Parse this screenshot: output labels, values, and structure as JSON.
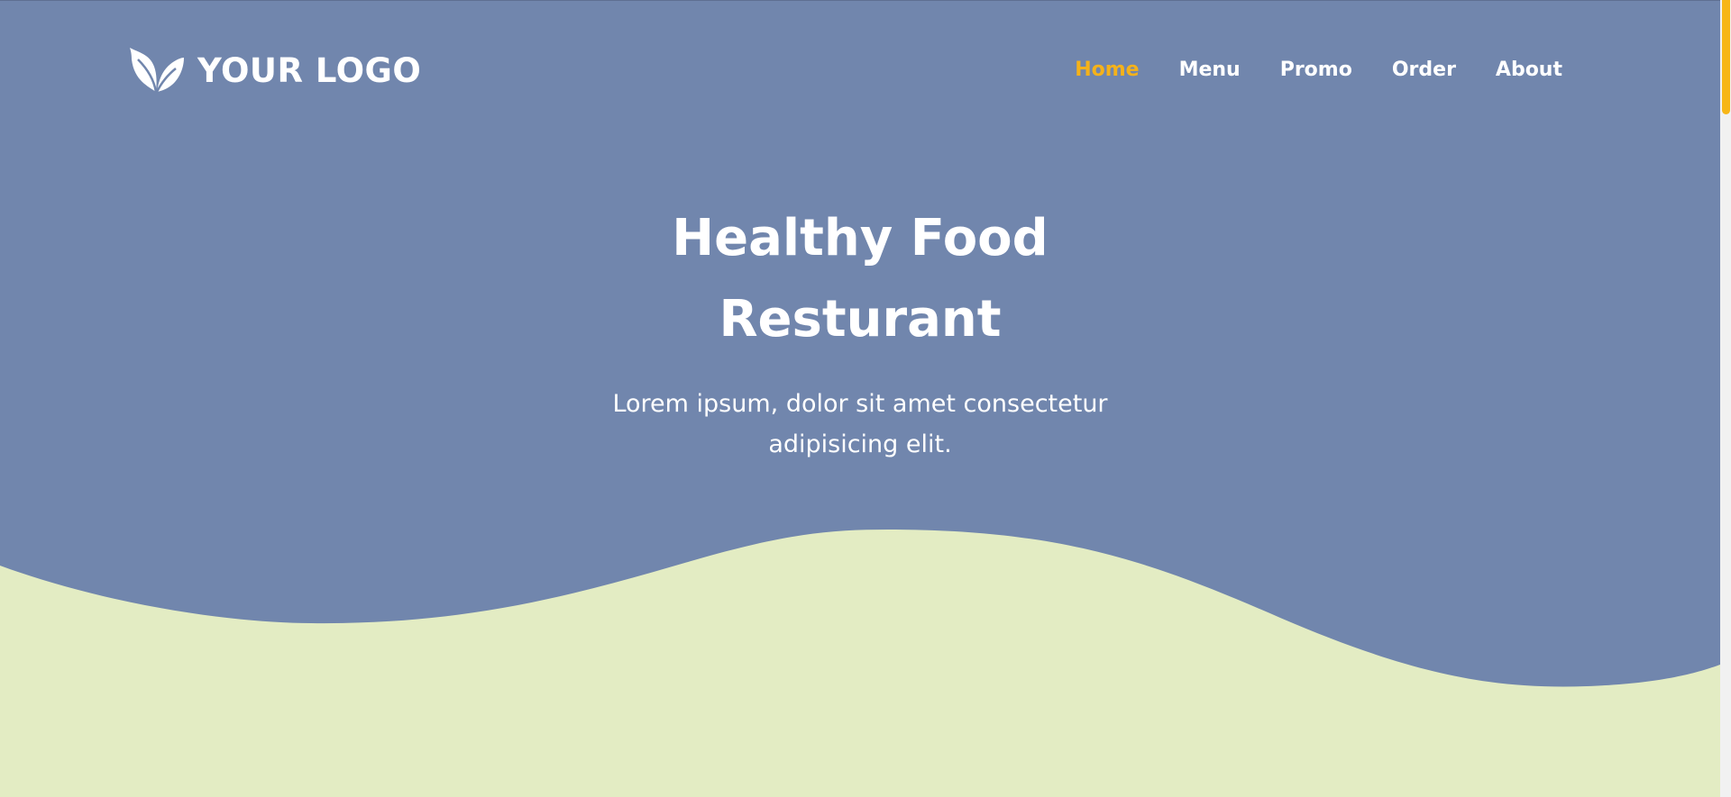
{
  "logo": {
    "text": "YOUR LOGO",
    "icon": "leaf-icon"
  },
  "nav": {
    "items": [
      {
        "label": "Home",
        "active": true
      },
      {
        "label": "Menu",
        "active": false
      },
      {
        "label": "Promo",
        "active": false
      },
      {
        "label": "Order",
        "active": false
      },
      {
        "label": "About",
        "active": false
      }
    ]
  },
  "hero": {
    "title_line1": "Healthy Food",
    "title_line2": "Resturant",
    "subtitle_line1": "Lorem ipsum, dolor sit amet consectetur",
    "subtitle_line2": "adipisicing elit."
  },
  "colors": {
    "background": "#7186ad",
    "wave": "#e3ecc3",
    "accent": "#f5b21a",
    "text": "#ffffff"
  }
}
